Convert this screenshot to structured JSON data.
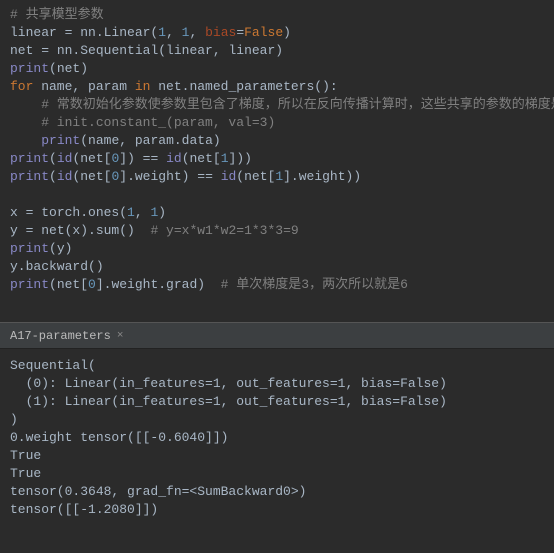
{
  "code": {
    "c0": "# 共享模型参数",
    "l1_a": "linear ",
    "l1_b": "=",
    "l1_c": " nn.Linear(",
    "l1_d": "1",
    "l1_e": ", ",
    "l1_f": "1",
    "l1_g": ", ",
    "l1_h": "bias",
    "l1_i": "=",
    "l1_j": "False",
    "l1_k": ")",
    "l2_a": "net ",
    "l2_b": "=",
    "l2_c": " nn.Sequential(linear",
    "l2_d": ", ",
    "l2_e": "linear)",
    "l3_a": "print",
    "l3_b": "(net)",
    "l4_a": "for",
    "l4_b": " name",
    "l4_c": ", ",
    "l4_d": "param ",
    "l4_e": "in",
    "l4_f": " net.named_parameters():",
    "c5": "    # 常数初始化参数使参数里包含了梯度，所以在反向传播计算时，这些共享的参数的梯度是累加的",
    "c6": "    # init.constant_(param, val=3)",
    "l7_a": "    ",
    "l7_b": "print",
    "l7_c": "(name",
    "l7_d": ", ",
    "l7_e": "param.data)",
    "l8_a": "print",
    "l8_b": "(",
    "l8_c": "id",
    "l8_d": "(net[",
    "l8_e": "0",
    "l8_f": "]) == ",
    "l8_g": "id",
    "l8_h": "(net[",
    "l8_i": "1",
    "l8_j": "]))",
    "l9_a": "print",
    "l9_b": "(",
    "l9_c": "id",
    "l9_d": "(net[",
    "l9_e": "0",
    "l9_f": "].weight) == ",
    "l9_g": "id",
    "l9_h": "(net[",
    "l9_i": "1",
    "l9_j": "].weight))",
    "l11_a": "x ",
    "l11_b": "=",
    "l11_c": " torch.ones(",
    "l11_d": "1",
    "l11_e": ", ",
    "l11_f": "1",
    "l11_g": ")",
    "l12_a": "y ",
    "l12_b": "=",
    "l12_c": " net(x).sum()  ",
    "l12_d": "# y=x*w1*w2=1*3*3=9",
    "l13_a": "print",
    "l13_b": "(y)",
    "l14_a": "y.backward()",
    "l15_a": "print",
    "l15_b": "(net[",
    "l15_c": "0",
    "l15_d": "].weight.grad)  ",
    "l15_e": "# 单次梯度是3，两次所以就是6"
  },
  "tab": {
    "name": "A17-parameters",
    "close": "×"
  },
  "out": {
    "o1": "Sequential(",
    "o2": "  (0): Linear(in_features=1, out_features=1, bias=False)",
    "o3": "  (1): Linear(in_features=1, out_features=1, bias=False)",
    "o4": ")",
    "o5": "0.weight tensor([[-0.6040]])",
    "o6": "True",
    "o7": "True",
    "o8": "tensor(0.3648, grad_fn=<SumBackward0>)",
    "o9": "tensor([[-1.2080]])"
  }
}
